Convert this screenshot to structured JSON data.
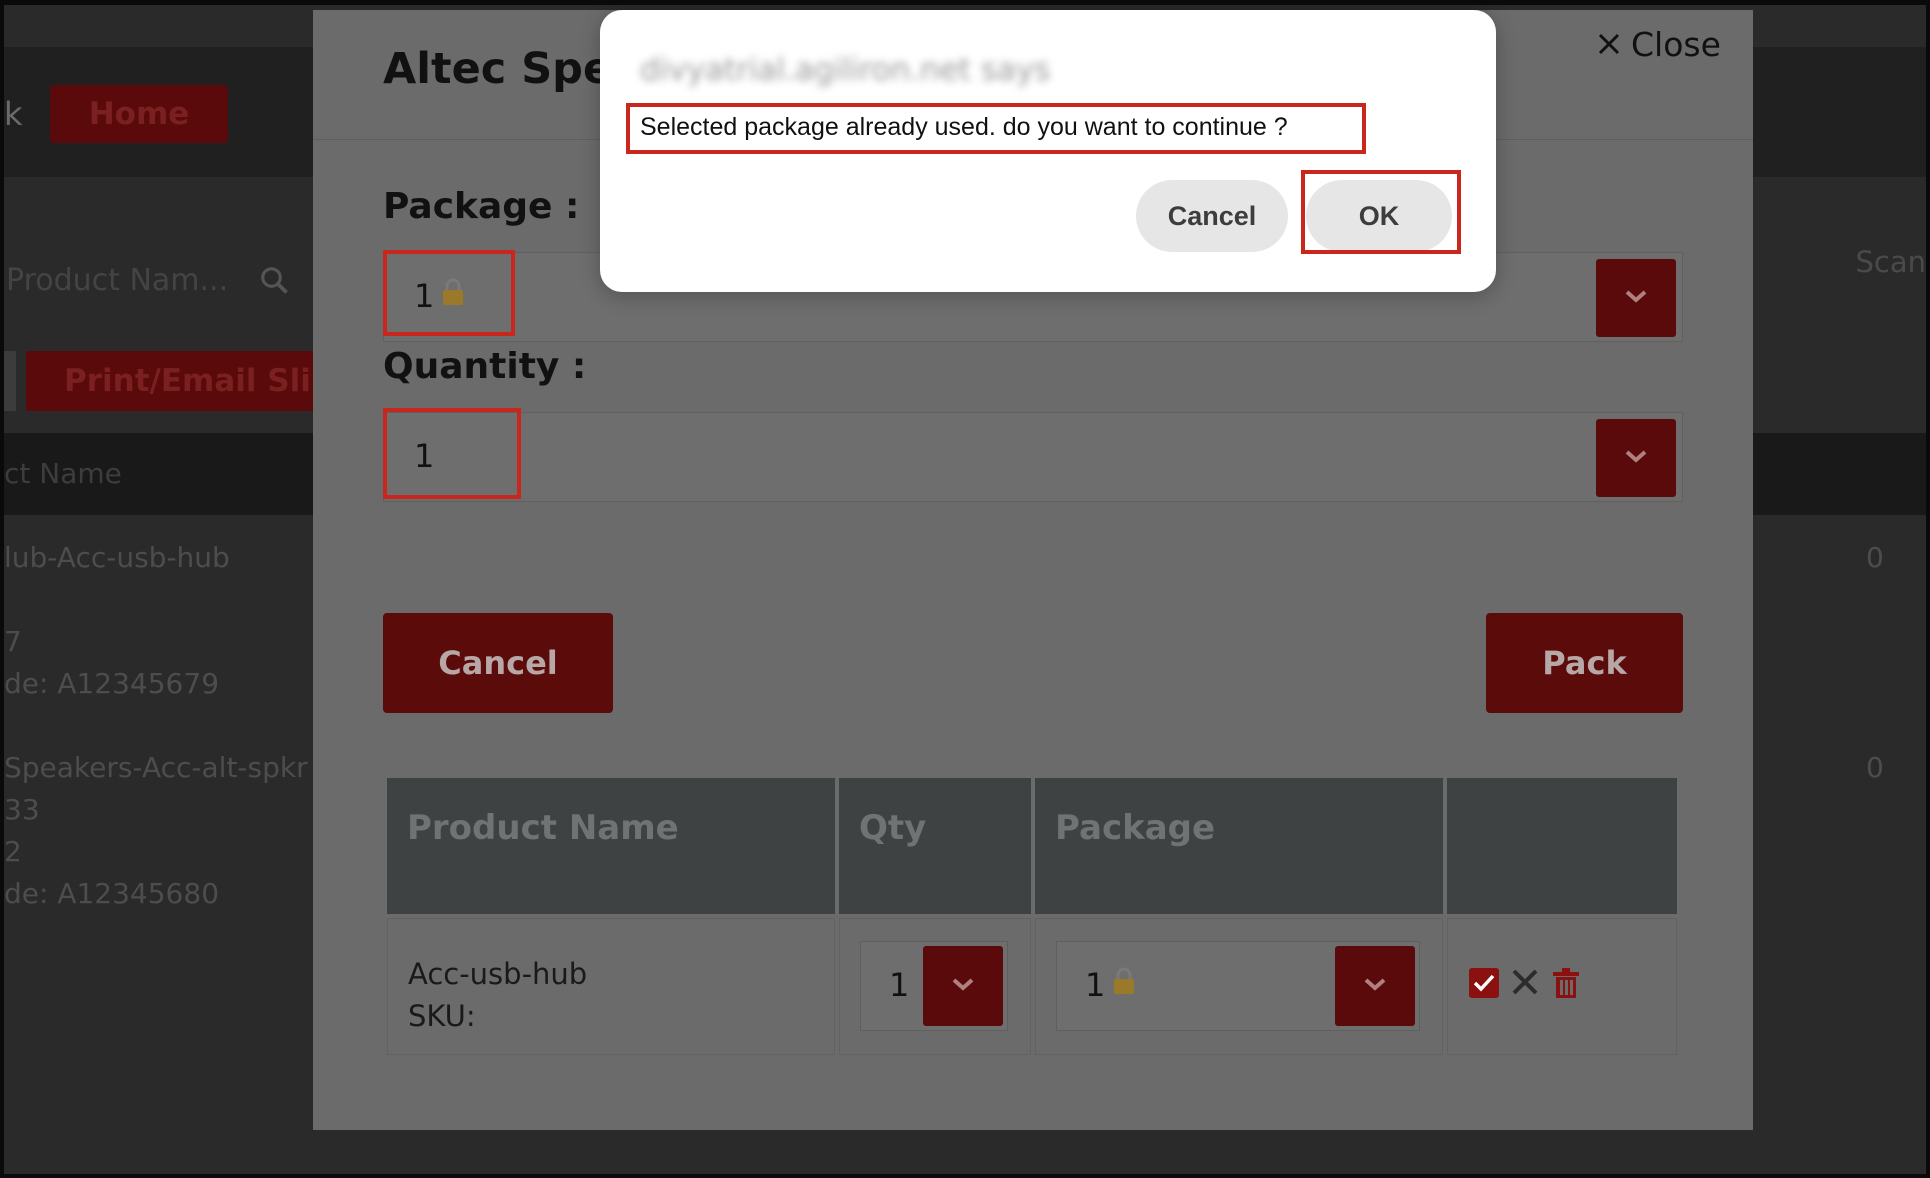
{
  "background": {
    "back_fragment": "k",
    "home_label": "Home",
    "search_placeholder": "Product Nam...",
    "print_label": "Print/Email Slip",
    "header_name": "ct Name",
    "scan_label": "Scan",
    "rows": [
      {
        "line1": "lub-Acc-usb-hub",
        "line2": "7",
        "line3": "de: A12345679",
        "count": "0"
      },
      {
        "line1": "Speakers-Acc-alt-spkr",
        "line2": "33",
        "line3": "2",
        "line4": "de: A12345680",
        "count": "0"
      }
    ]
  },
  "modal": {
    "title": "Altec Speakers",
    "close_label": "Close",
    "package_label": "Package :",
    "package_value": "1",
    "quantity_label": "Quantity :",
    "quantity_value": "1",
    "cancel_label": "Cancel",
    "pack_label": "Pack",
    "table": {
      "headers": [
        "Product Name",
        "Qty",
        "Package",
        ""
      ],
      "rows": [
        {
          "product": "Acc-usb-hub",
          "sku": "SKU:",
          "qty": "1",
          "package": "1"
        }
      ]
    }
  },
  "dialog": {
    "origin": "divyatrial.agiliron.net says",
    "message": "Selected package already used. do you want to continue ?",
    "cancel_label": "Cancel",
    "ok_label": "OK"
  },
  "colors": {
    "accent_dark_red": "#5a0a0a",
    "highlight_red": "#c9261e",
    "check_red": "#8b1010"
  }
}
